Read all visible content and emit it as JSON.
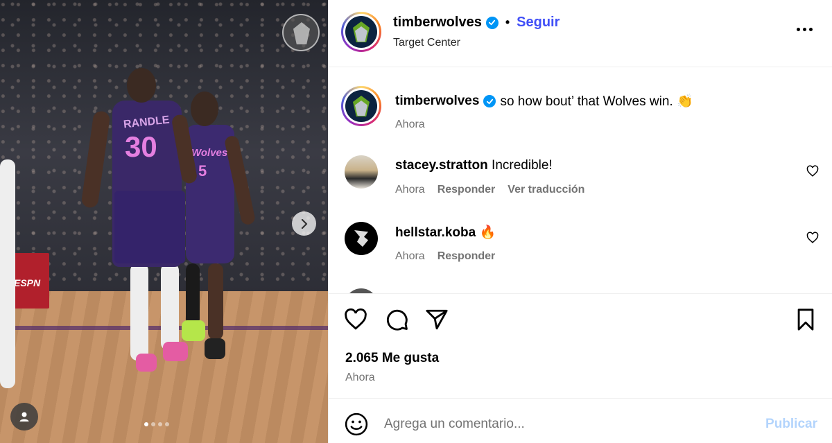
{
  "media": {
    "jersey_name": "RANDLE",
    "jersey_number": "30",
    "jersey2_text": "Wolves",
    "jersey2_number": "5",
    "ad_text": "ESPN",
    "carousel": {
      "total": 4,
      "active": 1
    }
  },
  "header": {
    "username": "timberwolves",
    "separator": "•",
    "follow_label": "Seguir",
    "location": "Target Center"
  },
  "caption": {
    "username": "timberwolves",
    "text": "so how bout’ that Wolves win. 👏",
    "time": "Ahora"
  },
  "comments": [
    {
      "username": "stacey.stratton",
      "text": "Incredible!",
      "time": "Ahora",
      "reply_label": "Responder",
      "translate_label": "Ver traducción"
    },
    {
      "username": "hellstar.koba",
      "text": "🔥",
      "time": "Ahora",
      "reply_label": "Responder"
    }
  ],
  "actions": {
    "likes": "2.065 Me gusta",
    "time": "Ahora"
  },
  "composer": {
    "placeholder": "Agrega un comentario...",
    "publish_label": "Publicar"
  },
  "colors": {
    "accent": "#4150f7",
    "verified": "#0095f6",
    "publish_disabled": "#b3d4fc",
    "meta": "#737373"
  }
}
